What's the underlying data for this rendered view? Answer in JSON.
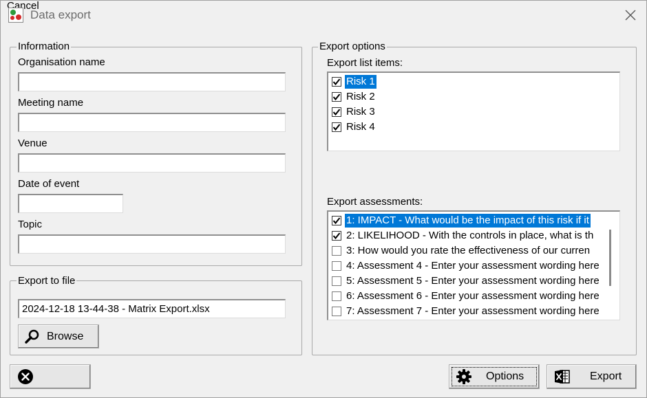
{
  "window": {
    "title": "Data export"
  },
  "information": {
    "legend": "Information",
    "organisation_label": "Organisation name",
    "organisation_value": "",
    "meeting_label": "Meeting name",
    "meeting_value": "",
    "venue_label": "Venue",
    "venue_value": "",
    "date_label": "Date of event",
    "date_value": "",
    "topic_label": "Topic",
    "topic_value": ""
  },
  "export_to_file": {
    "legend": "Export to file",
    "file_value": "2024-12-18 13-44-38 - Matrix Export.xlsx",
    "browse_label": "Browse"
  },
  "export_options": {
    "legend": "Export options",
    "list_items_label": "Export list items:",
    "list_items": [
      {
        "label": "Risk 1",
        "checked": true,
        "selected": true
      },
      {
        "label": "Risk 2",
        "checked": true,
        "selected": false
      },
      {
        "label": "Risk 3",
        "checked": true,
        "selected": false
      },
      {
        "label": "Risk 4",
        "checked": true,
        "selected": false
      }
    ],
    "assessments_label": "Export assessments:",
    "assessments": [
      {
        "label": "1: IMPACT - What would be the impact of this risk if it",
        "checked": true,
        "selected": true
      },
      {
        "label": "2: LIKELIHOOD - With the controls in place, what is th",
        "checked": true,
        "selected": false
      },
      {
        "label": "3: How would you rate the effectiveness of our curren",
        "checked": false,
        "selected": false
      },
      {
        "label": "4: Assessment 4 - Enter your assessment wording here",
        "checked": false,
        "selected": false
      },
      {
        "label": "5: Assessment 5 - Enter your assessment wording here",
        "checked": false,
        "selected": false
      },
      {
        "label": "6: Assessment 6 - Enter your assessment wording here",
        "checked": false,
        "selected": false
      },
      {
        "label": "7: Assessment 7 - Enter your assessment wording here",
        "checked": false,
        "selected": false
      }
    ]
  },
  "buttons": {
    "cancel": "Cancel",
    "options": "Options",
    "export": "Export"
  },
  "colors": {
    "selection": "#0078d7",
    "dialog_bg": "#f0f0f0",
    "excel_green": "#1e7145"
  },
  "icons": {
    "app": "app-icon",
    "close": "close-icon",
    "browse": "magnifier-icon",
    "cancel": "cancel-x-icon",
    "options": "gear-icon",
    "export": "excel-icon",
    "check": "check-icon"
  }
}
